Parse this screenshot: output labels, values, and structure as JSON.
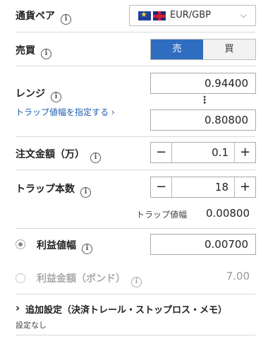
{
  "pair": {
    "label": "通貨ペア",
    "value": "EUR/GBP",
    "flags": [
      "eu-flag",
      "uk-flag"
    ]
  },
  "side": {
    "label": "売買",
    "sell": "売",
    "buy": "買",
    "selected": "sell",
    "accent": "#2f6dc0"
  },
  "range": {
    "label": "レンジ",
    "upper": "0.94400",
    "lower": "0.80800",
    "dots": "⋮",
    "link": "トラップ値幅を指定する ›"
  },
  "amount": {
    "label": "注文金額（万）",
    "value": "0.1",
    "minus": "−",
    "plus": "+"
  },
  "traps": {
    "label": "トラップ本数",
    "value": "18",
    "minus": "−",
    "plus": "+"
  },
  "trap_width": {
    "label": "トラップ値幅",
    "value": "0.00800"
  },
  "profit_width": {
    "label": "利益値幅",
    "value": "0.00700"
  },
  "profit_amount": {
    "label": "利益金額（ポンド）",
    "value": "7.00"
  },
  "advanced": {
    "label": "追加設定（決済トレール・ストップロス・メモ）",
    "sub": "設定なし",
    "chevron": "›"
  },
  "info_icon": "i",
  "chevron_down": "⌵"
}
